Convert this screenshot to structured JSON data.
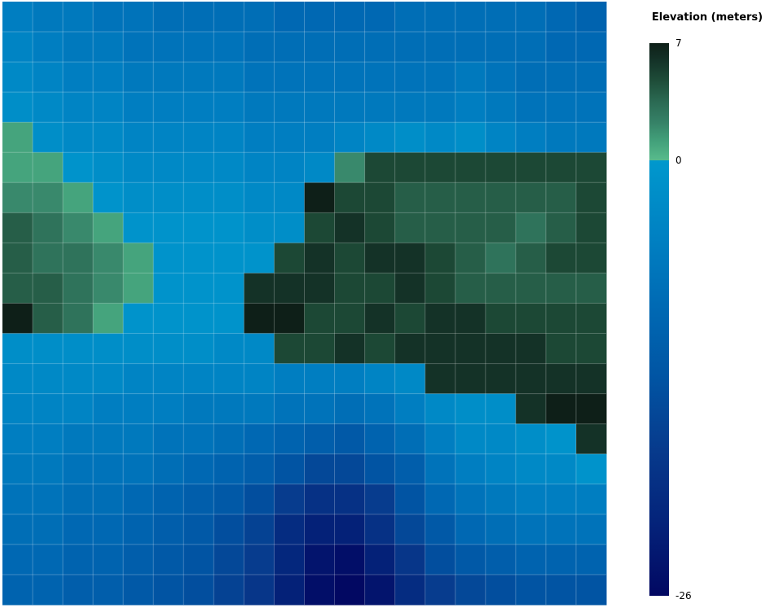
{
  "chart_data": {
    "type": "heatmap",
    "title": "",
    "xlabel": "",
    "ylabel": "",
    "grid": true,
    "legend": {
      "title": "Elevation (meters)",
      "placement": "right",
      "min": -26,
      "max": 7,
      "zero": 0,
      "tick_labels": [
        "7",
        "0",
        "-26"
      ]
    },
    "colors": {
      "positive_scale": [
        "#58bb8c",
        "#42a07a",
        "#358066",
        "#2b6a53",
        "#1f4f3a",
        "#15352a",
        "#0e1f18"
      ],
      "negative_scale": [
        "#0098cd",
        "#0082c3",
        "#006ab4",
        "#0154a3",
        "#073a8c",
        "#04237a",
        "#020862"
      ]
    },
    "z": [
      [
        -5,
        -6,
        -6,
        -7,
        -7,
        -8,
        -8,
        -8,
        -8,
        -9,
        -9,
        -9,
        -9,
        -8,
        -8,
        -8,
        -8,
        -8,
        -9,
        -10
      ],
      [
        -4,
        -5,
        -6,
        -6,
        -7,
        -7,
        -7,
        -7,
        -8,
        -8,
        -8,
        -8,
        -8,
        -8,
        -8,
        -8,
        -8,
        -8,
        -9,
        -9
      ],
      [
        -3,
        -4,
        -5,
        -5,
        -6,
        -6,
        -6,
        -6,
        -7,
        -7,
        -7,
        -7,
        -7,
        -7,
        -7,
        -6,
        -7,
        -8,
        -8,
        -8
      ],
      [
        -2,
        -3,
        -4,
        -4,
        -5,
        -5,
        -5,
        -5,
        -6,
        -6,
        -6,
        -6,
        -6,
        -6,
        -6,
        -5,
        -6,
        -7,
        -7,
        -7
      ],
      [
        1,
        -2,
        -3,
        -3,
        -4,
        -4,
        -4,
        -4,
        -5,
        -5,
        -5,
        -4,
        -3,
        -2,
        -3,
        -2,
        -4,
        -5,
        -6,
        -6
      ],
      [
        1,
        1,
        -1,
        -2,
        -3,
        -3,
        -3,
        -3,
        -4,
        -4,
        -3,
        2,
        5,
        5,
        5,
        5,
        5,
        5,
        5,
        5
      ],
      [
        2,
        2,
        1,
        -1,
        -2,
        -2,
        -2,
        -2,
        -3,
        -3,
        7,
        5,
        5,
        4,
        4,
        4,
        4,
        4,
        4,
        5
      ],
      [
        4,
        3,
        2,
        1,
        -1,
        -1,
        -1,
        -1,
        -2,
        -2,
        5,
        6,
        5,
        4,
        4,
        4,
        4,
        3,
        4,
        5
      ],
      [
        4,
        3,
        3,
        2,
        1,
        -1,
        -1,
        -1,
        -1,
        5,
        6,
        5,
        6,
        6,
        5,
        4,
        3,
        4,
        5,
        5
      ],
      [
        4,
        4,
        3,
        2,
        1,
        -1,
        -1,
        -1,
        6,
        6,
        6,
        5,
        5,
        6,
        5,
        4,
        4,
        4,
        4,
        4
      ],
      [
        7,
        4,
        3,
        1,
        -1,
        -1,
        -1,
        -1,
        7,
        7,
        5,
        5,
        6,
        5,
        6,
        6,
        5,
        5,
        5,
        5
      ],
      [
        -2,
        -2,
        -2,
        -2,
        -2,
        -2,
        -2,
        -3,
        -3,
        5,
        5,
        6,
        5,
        6,
        6,
        6,
        6,
        6,
        5,
        5
      ],
      [
        -3,
        -3,
        -3,
        -3,
        -4,
        -4,
        -4,
        -4,
        -4,
        -5,
        -5,
        -5,
        -4,
        -3,
        6,
        6,
        6,
        6,
        6,
        6
      ],
      [
        -4,
        -4,
        -4,
        -5,
        -5,
        -5,
        -6,
        -6,
        -6,
        -7,
        -7,
        -8,
        -7,
        -5,
        -3,
        -2,
        -2,
        6,
        7,
        7
      ],
      [
        -5,
        -5,
        -6,
        -6,
        -6,
        -7,
        -7,
        -8,
        -9,
        -10,
        -11,
        -12,
        -10,
        -8,
        -5,
        -3,
        -3,
        -2,
        -1,
        6
      ],
      [
        -6,
        -6,
        -7,
        -7,
        -7,
        -8,
        -9,
        -10,
        -11,
        -13,
        -15,
        -15,
        -13,
        -11,
        -7,
        -5,
        -4,
        -3,
        -3,
        -1
      ],
      [
        -7,
        -7,
        -8,
        -8,
        -9,
        -10,
        -11,
        -12,
        -14,
        -17,
        -19,
        -19,
        -17,
        -13,
        -9,
        -7,
        -6,
        -5,
        -5,
        -5
      ],
      [
        -8,
        -8,
        -9,
        -9,
        -10,
        -11,
        -12,
        -14,
        -16,
        -20,
        -22,
        -22,
        -19,
        -15,
        -12,
        -9,
        -8,
        -7,
        -7,
        -7
      ],
      [
        -9,
        -9,
        -10,
        -10,
        -11,
        -12,
        -13,
        -15,
        -17,
        -21,
        -24,
        -25,
        -22,
        -18,
        -14,
        -12,
        -11,
        -10,
        -10,
        -10
      ],
      [
        -10,
        -10,
        -11,
        -11,
        -12,
        -13,
        -14,
        -16,
        -18,
        -22,
        -25,
        -26,
        -24,
        -20,
        -17,
        -15,
        -14,
        -13,
        -13,
        -13
      ]
    ]
  }
}
